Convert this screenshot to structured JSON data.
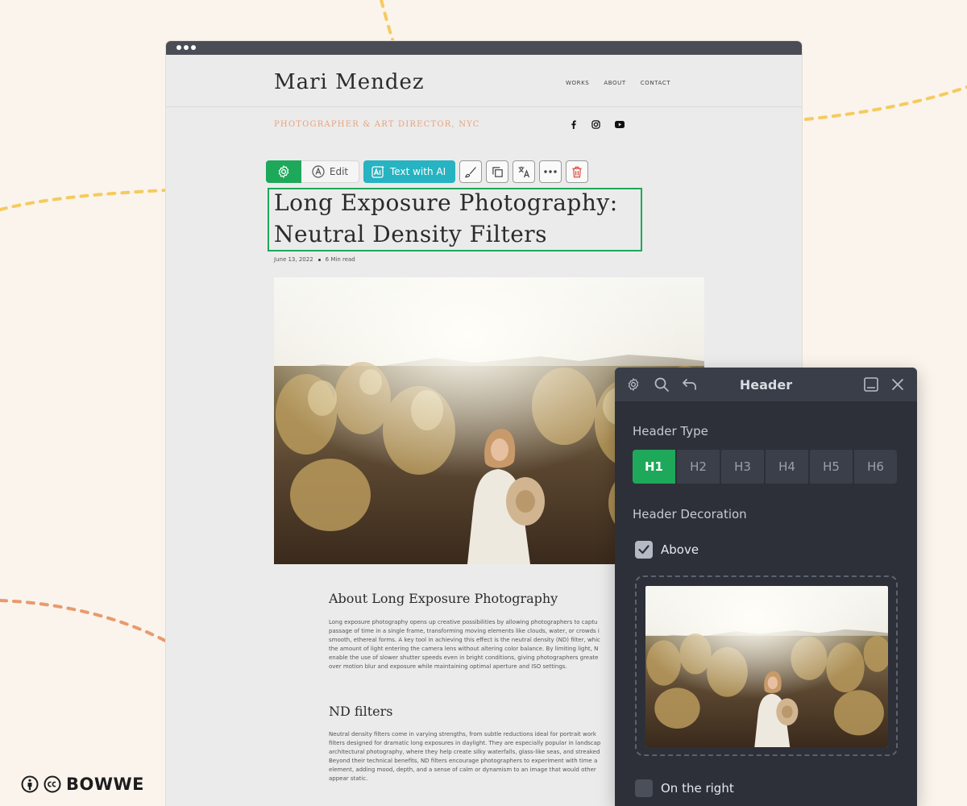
{
  "site": {
    "name": "Mari Mendez",
    "nav": [
      "WORKS",
      "ABOUT",
      "CONTACT"
    ],
    "tagline": "PHOTOGRAPHER & ART DIRECTOR, NYC"
  },
  "toolbar": {
    "edit_label": "Edit",
    "ai_label": "Text with AI"
  },
  "article": {
    "title_line1": "Long Exposure Photography:",
    "title_line2": "Neutral Density Filters",
    "date": "June 13, 2022",
    "read_time": "6 Min read",
    "section1_heading": "About Long Exposure Photography",
    "section1_text": "Long exposure photography opens up creative possibilities by allowing photographers to captu\npassage of time in a single frame, transforming moving elements like clouds, water, or crowds i\nsmooth, ethereal forms. A key tool in achieving this effect is the neutral density (ND) filter, whic\nthe amount of light entering the camera lens without altering color balance. By limiting light, N\nenable the use of slower shutter speeds even in bright conditions, giving photographers greate\nover motion blur and exposure while maintaining optimal aperture and ISO settings.",
    "section2_heading": "ND filters",
    "section2_text": "Neutral density filters come in varying strengths, from subtle reductions ideal for portrait work\nfilters designed for dramatic long exposures in daylight. They are especially popular in landscap\narchitectural photography, where they help create silky waterfalls, glass-like seas, and streaked\nBeyond their technical benefits, ND filters encourage photographers to experiment with time a\nelement, adding mood, depth, and a sense of calm or dynamism to an image that would other\nappear static."
  },
  "panel": {
    "title": "Header",
    "header_type_label": "Header Type",
    "header_types": [
      "H1",
      "H2",
      "H3",
      "H4",
      "H5",
      "H6"
    ],
    "selected_type": "H1",
    "decoration_label": "Header Decoration",
    "above_label": "Above",
    "above_checked": true,
    "right_label": "On the right",
    "right_checked": false
  },
  "brand": {
    "name": "BOWWE"
  },
  "colors": {
    "accent_green": "#1ea85a",
    "ai_teal": "#27b3c1",
    "panel_bg": "#2d3039",
    "tagline": "#e8a27c"
  }
}
